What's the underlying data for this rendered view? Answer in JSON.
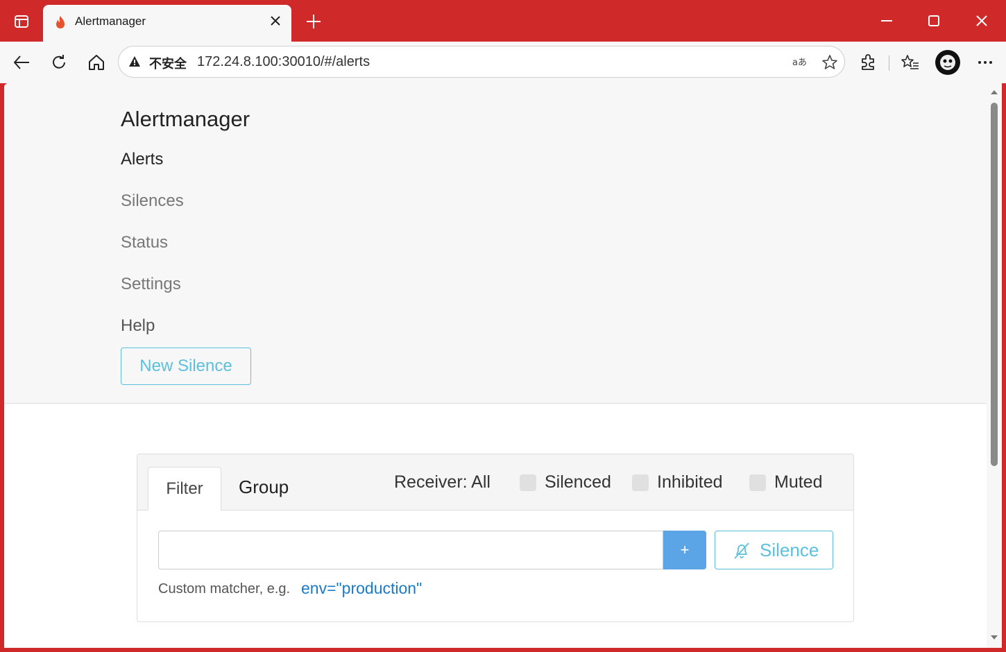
{
  "browser": {
    "tab_title": "Alertmanager",
    "security_label": "不安全",
    "url": "172.24.8.100:30010/#/alerts",
    "accent": "#cf2a29"
  },
  "app": {
    "brand": "Alertmanager",
    "nav": [
      "Alerts",
      "Silences",
      "Status",
      "Settings",
      "Help"
    ],
    "active_nav": "Alerts",
    "new_silence": "New Silence"
  },
  "filter_panel": {
    "tabs": [
      "Filter",
      "Group"
    ],
    "receiver": "Receiver: All",
    "checkboxes": [
      "Silenced",
      "Inhibited",
      "Muted"
    ],
    "plus": "+",
    "silence": "Silence",
    "hint": "Custom matcher, e.g.",
    "example": "env=\"production\""
  },
  "colors": {
    "info": "#5bc0de",
    "primary": "#5ba4e6",
    "link": "#1a7ac7"
  }
}
